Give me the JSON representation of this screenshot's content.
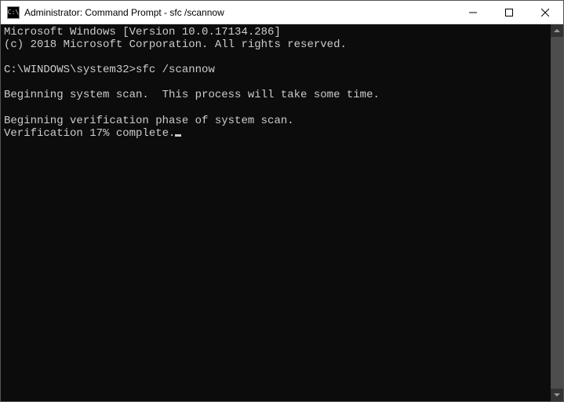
{
  "titlebar": {
    "icon_text": "C:\\",
    "title": "Administrator: Command Prompt - sfc  /scannow"
  },
  "terminal": {
    "line1": "Microsoft Windows [Version 10.0.17134.286]",
    "line2": "(c) 2018 Microsoft Corporation. All rights reserved.",
    "blank1": "",
    "prompt": "C:\\WINDOWS\\system32>",
    "command": "sfc /scannow",
    "blank2": "",
    "line3": "Beginning system scan.  This process will take some time.",
    "blank3": "",
    "line4": "Beginning verification phase of system scan.",
    "line5": "Verification 17% complete."
  }
}
